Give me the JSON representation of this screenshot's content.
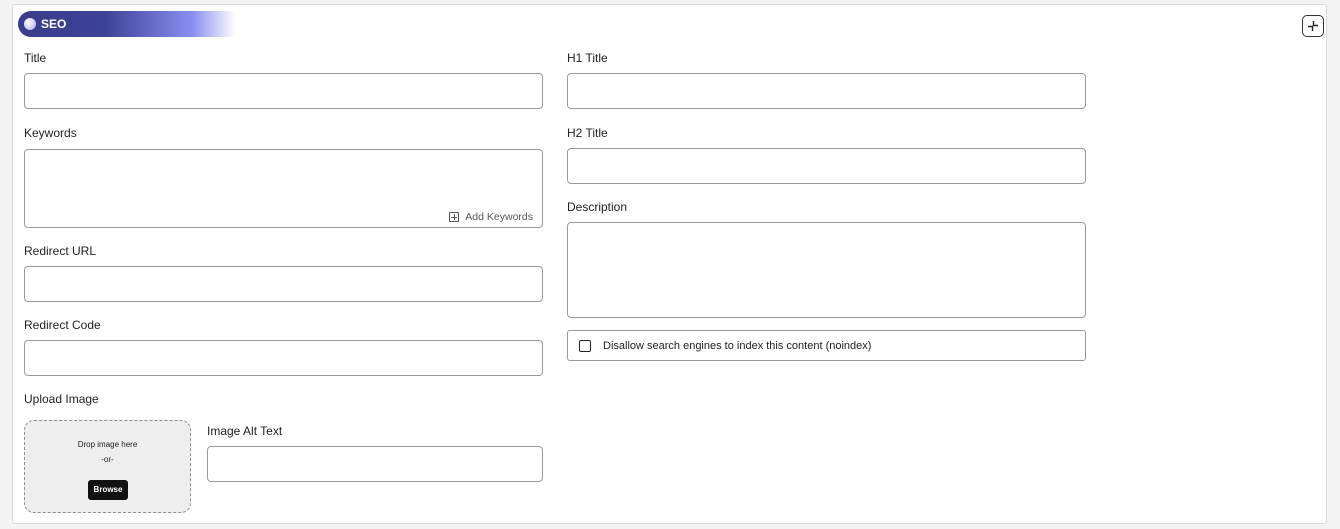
{
  "section": {
    "title": "SEO",
    "collapse_icon": "collapse-icon"
  },
  "fields": {
    "title": {
      "label": "Title",
      "value": ""
    },
    "keywords": {
      "label": "Keywords",
      "value": "",
      "add_label": "Add Keywords"
    },
    "redirect_url": {
      "label": "Redirect URL",
      "value": ""
    },
    "redirect_code": {
      "label": "Redirect Code",
      "value": ""
    },
    "upload_image": {
      "label": "Upload Image",
      "drop_text": "Drop image here",
      "or_text": "-or-",
      "browse_label": "Browse"
    },
    "image_alt": {
      "label": "Image Alt Text",
      "value": ""
    },
    "h1_title": {
      "label": "H1 Title",
      "value": ""
    },
    "h2_title": {
      "label": "H2 Title",
      "value": ""
    },
    "description": {
      "label": "Description",
      "value": ""
    },
    "noindex": {
      "label": "Disallow search engines to index this content (noindex)",
      "checked": false
    }
  }
}
